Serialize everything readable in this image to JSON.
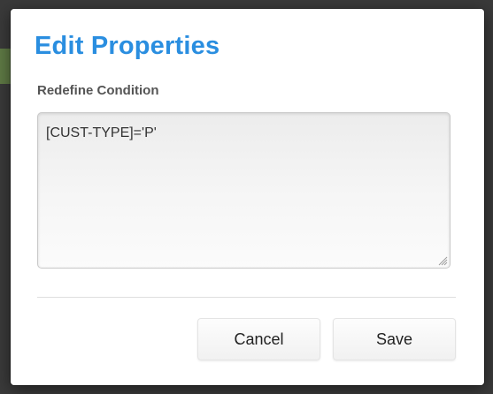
{
  "dialog": {
    "title": "Edit Properties",
    "field_label": "Redefine Condition",
    "field_value": "[CUST-TYPE]='P'"
  },
  "buttons": {
    "cancel_label": "Cancel",
    "save_label": "Save"
  },
  "colors": {
    "title_accent": "#2a8ee0",
    "label_text": "#555555"
  },
  "icons": {
    "resize": "resize-grip-icon"
  }
}
